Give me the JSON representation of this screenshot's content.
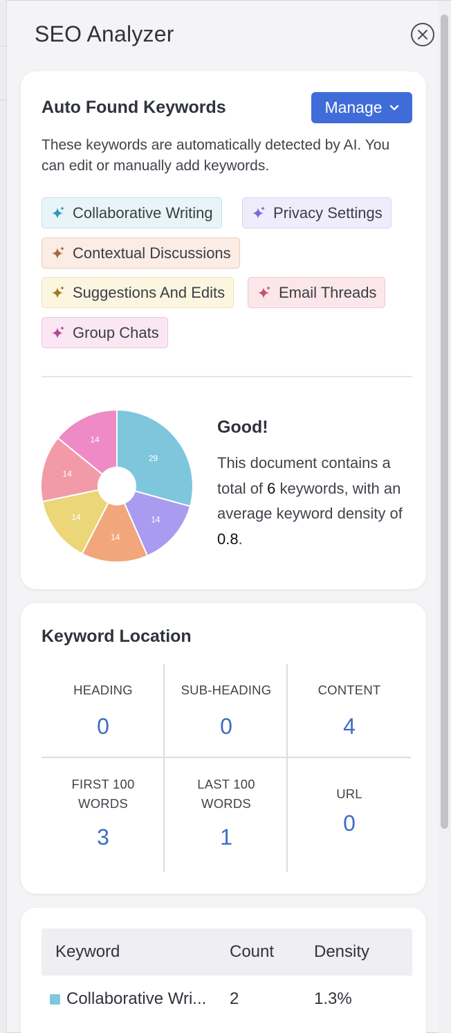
{
  "panel": {
    "title": "SEO Analyzer"
  },
  "keywords_card": {
    "heading": "Auto Found Keywords",
    "manage_label": "Manage",
    "description": "These keywords are automatically detected by AI. You can edit or manually add keywords.",
    "tags": [
      {
        "label": "Collaborative Writing",
        "bg": "#e8f5f8",
        "border": "#bfe3ec",
        "spark": "#2f9bb5"
      },
      {
        "label": "Privacy Settings",
        "bg": "#efedfb",
        "border": "#d9d3f4",
        "spark": "#7b6ad6"
      },
      {
        "label": "Contextual Discussions",
        "bg": "#fbece4",
        "border": "#f2ccb8",
        "spark": "#a8683d"
      },
      {
        "label": "Suggestions And Edits",
        "bg": "#fcf6e1",
        "border": "#f0e2b0",
        "spark": "#a07a1f"
      },
      {
        "label": "Email Threads",
        "bg": "#fbe7ea",
        "border": "#f2c6cd",
        "spark": "#c2546a"
      },
      {
        "label": "Group Chats",
        "bg": "#fbe7f3",
        "border": "#f2c3de",
        "spark": "#b04a8f"
      }
    ],
    "summary_title": "Good!",
    "summary_prefix": "This document contains a total of ",
    "summary_count": "6",
    "summary_mid": " keywords, with an average keyword density of ",
    "summary_density": "0.8",
    "summary_suffix": "."
  },
  "chart_data": {
    "type": "pie",
    "values": [
      29,
      14,
      14,
      14,
      14,
      14
    ],
    "labels": [
      "29",
      "14",
      "14",
      "14",
      "14",
      "14"
    ],
    "colors": [
      "#7ec6dc",
      "#a99cf0",
      "#f1a77b",
      "#ebd678",
      "#f29aa8",
      "#ee8ac6"
    ],
    "donut_hole": true
  },
  "location_card": {
    "heading": "Keyword Location",
    "cells": [
      {
        "label": "HEADING",
        "value": "0"
      },
      {
        "label": "SUB-HEADING",
        "value": "0"
      },
      {
        "label": "CONTENT",
        "value": "4"
      },
      {
        "label": "FIRST 100 WORDS",
        "value": "3"
      },
      {
        "label": "LAST 100 WORDS",
        "value": "1"
      },
      {
        "label": "URL",
        "value": "0"
      }
    ]
  },
  "table_card": {
    "columns": [
      "Keyword",
      "Count",
      "Density"
    ],
    "rows": [
      {
        "keyword": "Collaborative Wri...",
        "count": "2",
        "density": "1.3%"
      }
    ]
  }
}
